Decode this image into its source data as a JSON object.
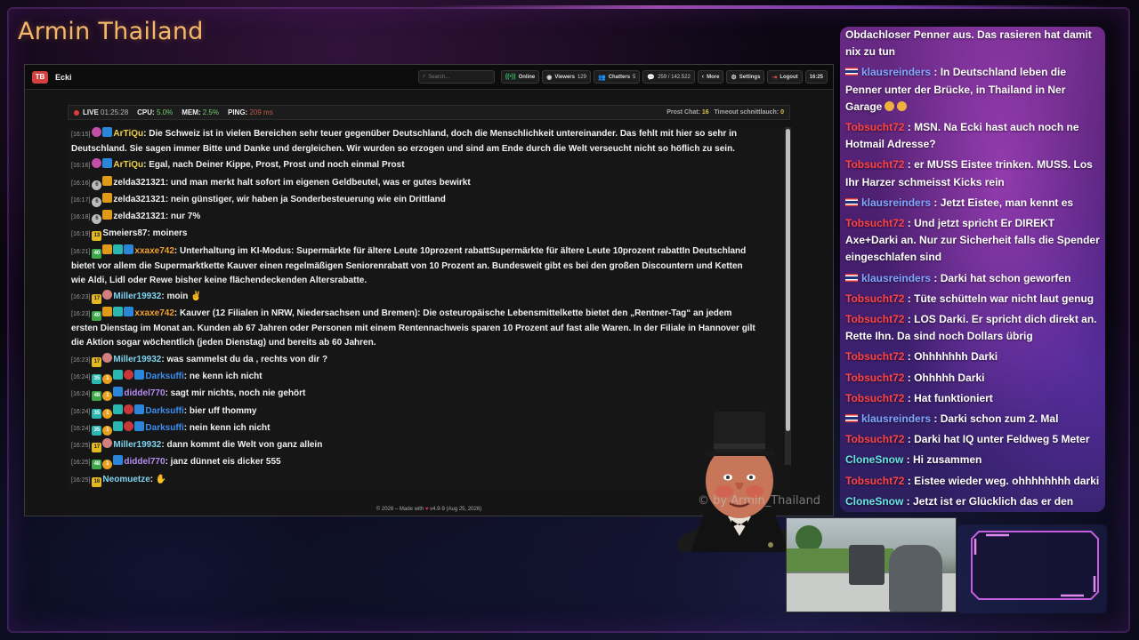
{
  "overlay": {
    "streamer_name": "Armin Thailand",
    "watermark": "© by Armin_Thailand"
  },
  "app": {
    "logo_text": "TB",
    "name": "Ecki",
    "header": {
      "search_placeholder": "Search...",
      "online_label": "Online",
      "viewers_label": "Viewers",
      "viewers_count": "129",
      "chatters_label": "Chatters",
      "chatters_count": "5",
      "messages_count": "259 / 142.522",
      "more_label": "More",
      "settings_label": "Settings",
      "logout_label": "Logout",
      "time": "16:25"
    },
    "status": {
      "live_label": "LIVE",
      "live_time": "01:25:28",
      "cpu_label": "CPU:",
      "cpu_value": "5.0%",
      "mem_label": "MEM:",
      "mem_value": "2.5%",
      "ping_label": "PING:",
      "ping_value": "209 ms",
      "prost_label": "Prost Chat:",
      "prost_value": "16",
      "timeout_label": "Timeout schnittlauch:",
      "timeout_value": "0"
    },
    "footer": {
      "prefix": "© 2026 – Made with",
      "suffix": "v4.9-9 (Aug 25, 2026)"
    },
    "colors": {
      "live_dot": "#e23a3a",
      "online": "#35c26a",
      "heart": "#e03050"
    }
  },
  "messages": [
    {
      "time": "[16:15]",
      "badges": [
        "pink",
        "blue"
      ],
      "user": "ArTiQu",
      "user_color": "yellow",
      "text": ": Die Schweiz ist in vielen Bereichen sehr teuer gegenüber Deutschland, doch die Menschlichkeit untereinander. Das fehlt mit hier so sehr in Deutschland. Sie sagen immer Bitte und Danke und dergleichen. Wir wurden so erzogen und sind am Ende durch die Welt verseucht nicht so höflich zu sein."
    },
    {
      "time": "[16:16]",
      "badges": [
        "pink",
        "blue"
      ],
      "user": "ArTiQu",
      "user_color": "yellow",
      "text": ": Egal, nach Deiner Kippe, Prost, Prost und noch einmal Prost"
    },
    {
      "time": "[16:16]",
      "badges": [
        "grey",
        "crown"
      ],
      "badge_text": [
        "6",
        ""
      ],
      "user": "zelda321321",
      "user_color": "white",
      "text": ": und man merkt halt sofort im eigenen Geldbeutel, was er gutes bewirkt"
    },
    {
      "time": "[16:17]",
      "badges": [
        "grey",
        "crown"
      ],
      "badge_text": [
        "6",
        ""
      ],
      "user": "zelda321321",
      "user_color": "white",
      "text": ": nein günstiger, wir haben ja Sonderbesteuerung wie ein Drittland"
    },
    {
      "time": "[16:18]",
      "badges": [
        "grey",
        "crown"
      ],
      "badge_text": [
        "6",
        ""
      ],
      "user": "zelda321321",
      "user_color": "white",
      "text": ": nur 7%"
    },
    {
      "time": "[16:19]",
      "badges": [
        "yellow"
      ],
      "badge_text": [
        "13"
      ],
      "user": "Smeiers87",
      "user_color": "white",
      "text": ": moiners"
    },
    {
      "time": "[16:21]",
      "badges": [
        "green",
        "crown",
        "teal",
        "blue"
      ],
      "badge_text": [
        "40",
        "",
        "",
        ""
      ],
      "user": "xxaxe742",
      "user_color": "orange",
      "text": ": Unterhaltung im KI-Modus: Supermärkte für ältere Leute 10prozent rabattSupermärkte für ältere Leute 10prozent rabattIn Deutschland bietet vor allem die Supermarktkette Kauver einen regelmäßigen Seniorenrabatt von 10 Prozent an. Bundesweit gibt es bei den großen Discountern und Ketten wie Aldi, Lidl oder Rewe bisher keine flächendeckenden Altersrabatte."
    },
    {
      "time": "[16:23]",
      "badges": [
        "yellow",
        "face"
      ],
      "badge_text": [
        "17",
        ""
      ],
      "user": "Miller19932",
      "user_color": "cyan",
      "text": ": moin ✌"
    },
    {
      "time": "[16:23]",
      "badges": [
        "green",
        "crown",
        "teal",
        "blue"
      ],
      "badge_text": [
        "40",
        "",
        "",
        ""
      ],
      "user": "xxaxe742",
      "user_color": "orange",
      "text": ": Kauver (12 Filialen in NRW, Niedersachsen und Bremen): Die osteuropäische Lebensmittelkette bietet den „Rentner-Tag“ an jedem ersten Dienstag im Monat an. Kunden ab 67 Jahren oder Personen mit einem Rentennachweis sparen 10 Prozent auf fast alle Waren. In der Filiale in Hannover gilt die Aktion sogar wöchentlich (jeden Dienstag) und bereits ab 60 Jahren."
    },
    {
      "time": "[16:23]",
      "badges": [
        "yellow",
        "face"
      ],
      "badge_text": [
        "17",
        ""
      ],
      "user": "Miller19932",
      "user_color": "cyan",
      "text": ": was sammelst du da , rechts von dir ?"
    },
    {
      "time": "[16:24]",
      "badges": [
        "teal",
        "orange",
        "teal",
        "red",
        "blue"
      ],
      "badge_text": [
        "35",
        "1",
        "",
        "",
        ""
      ],
      "user": "Darksuffi",
      "user_color": "blue",
      "text": ": ne kenn ich nicht"
    },
    {
      "time": "[16:24]",
      "badges": [
        "green",
        "orange",
        "blue"
      ],
      "badge_text": [
        "48",
        "1",
        ""
      ],
      "user": "diddel770",
      "user_color": "purple",
      "text": ": sagt mir nichts, noch nie gehört"
    },
    {
      "time": "[16:24]",
      "badges": [
        "teal",
        "orange",
        "teal",
        "red",
        "blue"
      ],
      "badge_text": [
        "35",
        "1",
        "",
        "",
        ""
      ],
      "user": "Darksuffi",
      "user_color": "blue",
      "text": ": bier uff thommy"
    },
    {
      "time": "[16:24]",
      "badges": [
        "teal",
        "orange",
        "teal",
        "red",
        "blue"
      ],
      "badge_text": [
        "35",
        "1",
        "",
        "",
        ""
      ],
      "user": "Darksuffi",
      "user_color": "blue",
      "text": ": nein kenn ich nicht"
    },
    {
      "time": "[16:25]",
      "badges": [
        "yellow",
        "face"
      ],
      "badge_text": [
        "17",
        ""
      ],
      "user": "Miller19932",
      "user_color": "cyan",
      "text": ": dann kommt die Welt von ganz allein"
    },
    {
      "time": "[16:25]",
      "badges": [
        "green",
        "orange",
        "blue"
      ],
      "badge_text": [
        "48",
        "1",
        ""
      ],
      "user": "diddel770",
      "user_color": "purple",
      "text": ": janz dünnet eis dicker 555"
    },
    {
      "time": "[16:25]",
      "badges": [
        "yellow"
      ],
      "badge_text": [
        "16"
      ],
      "user": "Neomuetze",
      "user_color": "cyan",
      "text": ": ✋"
    }
  ],
  "overlay_chat": [
    {
      "flag": false,
      "user": "",
      "user_color": "",
      "text": "Obdachloser Penner aus. Das rasieren hat damit nix zu tun"
    },
    {
      "flag": true,
      "user": "klausreinders",
      "user_color": "blue",
      "text": " : In Deutschland leben die Penner unter der Brücke, in Thailand in Ner Garage",
      "emoji": true
    },
    {
      "flag": false,
      "user": "Tobsucht72",
      "user_color": "red",
      "text": " : MSN. Na Ecki hast auch noch ne Hotmail Adresse?"
    },
    {
      "flag": false,
      "user": "Tobsucht72",
      "user_color": "red",
      "text": " : er MUSS Eistee trinken. MUSS. Los Ihr Harzer schmeisst Kicks rein"
    },
    {
      "flag": true,
      "user": "klausreinders",
      "user_color": "blue",
      "text": " : Jetzt Eistee, man kennt es"
    },
    {
      "flag": false,
      "user": "Tobsucht72",
      "user_color": "red",
      "text": " : Und jetzt spricht Er DIREKT Axe+Darki an. Nur zur Sicherheit falls die Spender eingeschlafen sind"
    },
    {
      "flag": true,
      "user": "klausreinders",
      "user_color": "blue",
      "text": " : Darki hat schon geworfen"
    },
    {
      "flag": false,
      "user": "Tobsucht72",
      "user_color": "red",
      "text": " : Tüte schütteln war nicht laut genug"
    },
    {
      "flag": false,
      "user": "Tobsucht72",
      "user_color": "red",
      "text": " : LOS Darki. Er spricht dich direkt an. Rette Ihn. Da sind noch Dollars übrig"
    },
    {
      "flag": false,
      "user": "Tobsucht72",
      "user_color": "red",
      "text": " : Ohhhhhhh Darki"
    },
    {
      "flag": false,
      "user": "Tobsucht72",
      "user_color": "red",
      "text": " : Ohhhhh Darki"
    },
    {
      "flag": false,
      "user": "Tobsucht72",
      "user_color": "red",
      "text": " : Hat funktioniert"
    },
    {
      "flag": true,
      "user": "klausreinders",
      "user_color": "blue",
      "text": " : Darki schon zum 2. Mal"
    },
    {
      "flag": false,
      "user": "Tobsucht72",
      "user_color": "red",
      "text": " : Darki hat IQ unter Feldweg 5 Meter"
    },
    {
      "flag": false,
      "user": "CloneSnow",
      "user_color": "cyan",
      "text": " : Hi zusammen"
    },
    {
      "flag": false,
      "user": "Tobsucht72",
      "user_color": "red",
      "text": " : Eistee wieder weg. ohhhhhhhh darki"
    },
    {
      "flag": false,
      "user": "CloneSnow",
      "user_color": "cyan",
      "text": " : Jetzt ist er Glücklich das er den Eistee nicht trinken muss"
    }
  ]
}
